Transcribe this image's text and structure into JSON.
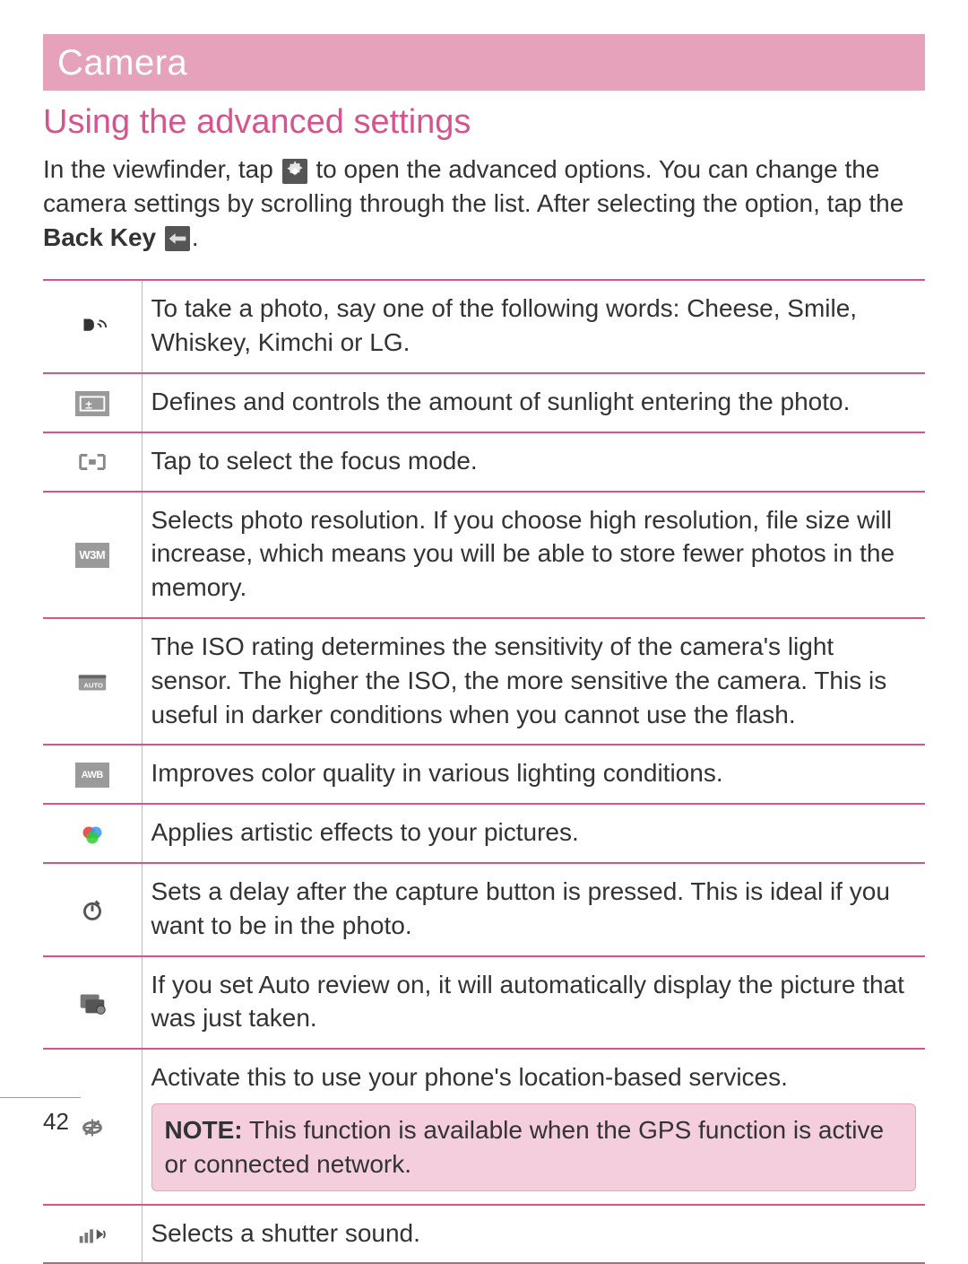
{
  "header": {
    "title": "Camera"
  },
  "section": {
    "subtitle": "Using the advanced settings"
  },
  "intro": {
    "part1": "In the viewfinder, tap ",
    "part2": " to open the advanced options. You can change the camera settings by scrolling through the list. After selecting the option, tap the ",
    "back_key_label": "Back Key",
    "part3": "."
  },
  "rows": [
    {
      "icon_name": "voice-shutter-icon",
      "desc": "To take a photo, say one of the following words: Cheese, Smile, Whiskey, Kimchi or LG."
    },
    {
      "icon_name": "brightness-icon",
      "desc": "Defines and controls the amount of sunlight entering the photo."
    },
    {
      "icon_name": "focus-mode-icon",
      "desc": "Tap to select the focus mode."
    },
    {
      "icon_name": "resolution-icon",
      "icon_text": "W3M",
      "desc": "Selects photo resolution. If you choose high resolution, file size will increase, which means you will be able to store fewer photos in the memory."
    },
    {
      "icon_name": "iso-icon",
      "desc": "The ISO rating determines the sensitivity of the camera's light sensor. The higher the ISO, the more sensitive the camera. This is useful in darker conditions when you cannot use the flash."
    },
    {
      "icon_name": "white-balance-icon",
      "icon_text": "AWB",
      "desc": "Improves color quality in various lighting conditions."
    },
    {
      "icon_name": "color-effect-icon",
      "desc": "Applies artistic effects to your pictures."
    },
    {
      "icon_name": "timer-icon",
      "desc": "Sets a delay after the capture button is pressed. This is ideal if you want to be in the photo."
    },
    {
      "icon_name": "auto-review-icon",
      "desc": "If you set Auto review on, it will automatically display the picture that was just taken."
    },
    {
      "icon_name": "geotag-icon",
      "desc": "Activate this to use your phone's location-based services.",
      "note_label": "NOTE:",
      "note_text": " This function is available when the GPS function is active or connected network."
    },
    {
      "icon_name": "shutter-sound-icon",
      "desc": "Selects a shutter sound."
    }
  ],
  "page_number": "42"
}
